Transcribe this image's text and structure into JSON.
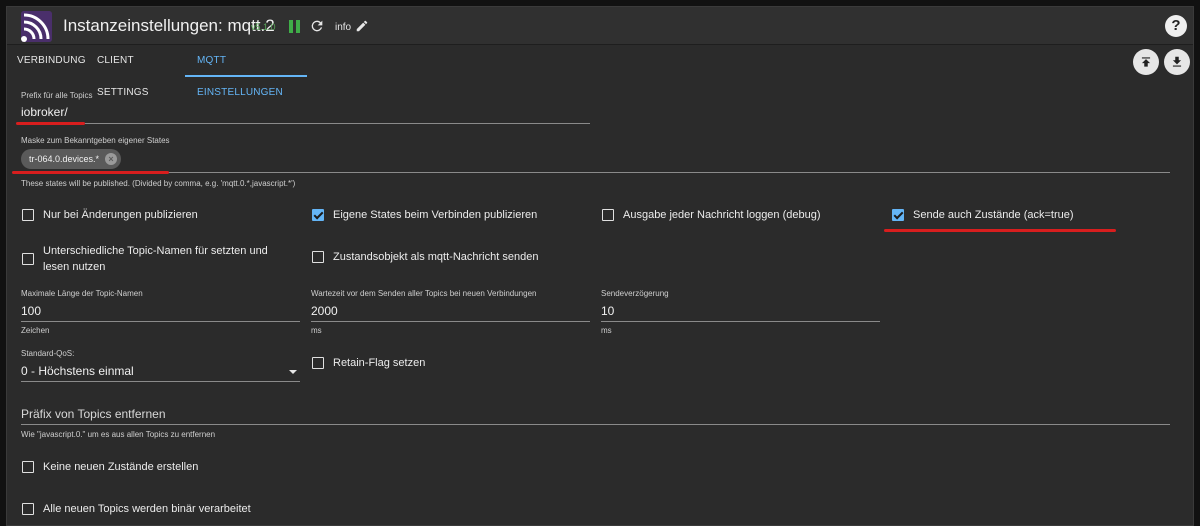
{
  "header": {
    "title": "Instanzeinstellungen: mqtt.2",
    "version": "v5.1.0",
    "loglevel": "info",
    "help": "?"
  },
  "tabs": [
    {
      "label": "VERBINDUNG"
    },
    {
      "label": "CLIENT SETTINGS"
    },
    {
      "label": "MQTT EINSTELLUNGEN"
    }
  ],
  "form": {
    "prefix": {
      "label": "Prefix für alle Topics",
      "value": "iobroker/"
    },
    "mask": {
      "label": "Maske zum Bekanntgeben eigener States",
      "chip": "tr-064.0.devices.*",
      "helper": "These states will be published. (Divided by comma, e.g. 'mqtt.0.*,javascript.*')"
    },
    "checkboxes_row1": [
      {
        "label": "Nur bei Änderungen publizieren",
        "checked": false
      },
      {
        "label": "Eigene States beim Verbinden publizieren",
        "checked": true
      },
      {
        "label": "Ausgabe jeder Nachricht loggen (debug)",
        "checked": false
      },
      {
        "label": "Sende auch Zustände (ack=true)",
        "checked": true
      }
    ],
    "different_topics": {
      "label_line1": "Unterschiedliche Topic-Namen für setzten und",
      "label_line2": "lesen nutzen",
      "checked": false
    },
    "state_object": {
      "label": "Zustandsobjekt als mqtt-Nachricht senden",
      "checked": false
    },
    "max_length": {
      "label": "Maximale Länge der Topic-Namen",
      "value": "100",
      "unit": "Zeichen"
    },
    "wait_time": {
      "label": "Wartezeit vor dem Senden aller Topics bei neuen Verbindungen",
      "value": "2000",
      "unit": "ms"
    },
    "send_delay": {
      "label": "Sendeverzögerung",
      "value": "10",
      "unit": "ms"
    },
    "qos": {
      "label": "Standard-QoS:",
      "value": "0 - Höchstens einmal"
    },
    "retain": {
      "label": "Retain-Flag setzen",
      "checked": false
    },
    "remove_prefix": {
      "placeholder": "Präfix von Topics entfernen",
      "helper": "Wie \"javascript.0.\" um es aus allen Topics zu entfernen"
    },
    "no_new_states": {
      "label": "Keine neuen Zustände erstellen",
      "checked": false
    },
    "binary_topics": {
      "label": "Alle neuen Topics werden binär verarbeitet",
      "checked": false
    }
  },
  "colors": {
    "accent": "#64b5f6",
    "annotation": "#d81e1e",
    "logo": "#4a2f6b",
    "running": "#3fae48"
  }
}
